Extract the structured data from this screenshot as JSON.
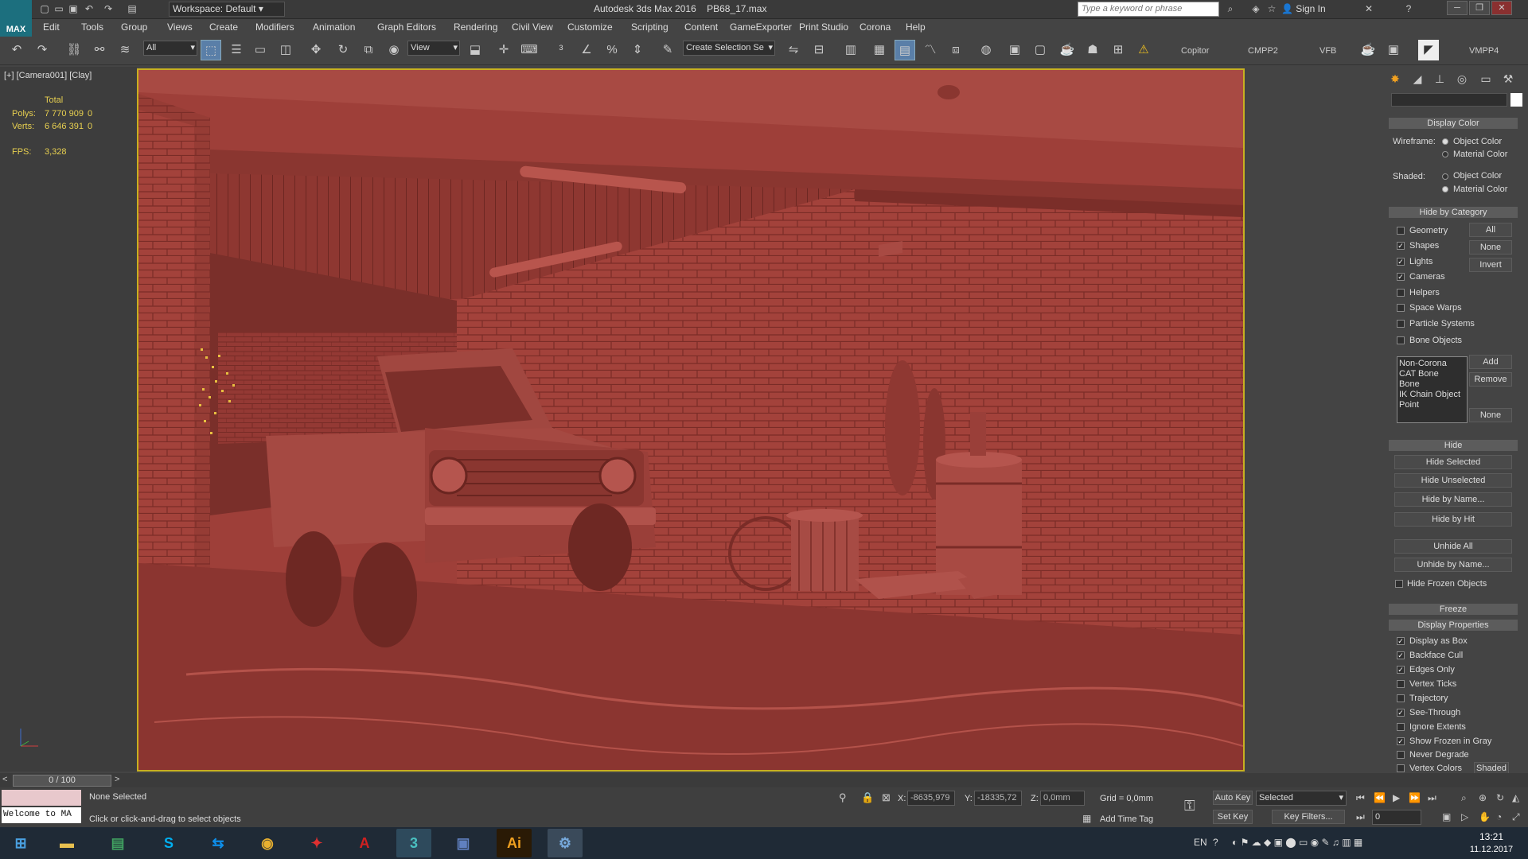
{
  "titlebar": {
    "logo": "MAX",
    "workspace": "Workspace: Default",
    "app_title": "Autodesk 3ds Max 2016",
    "file_name": "PB68_17.max",
    "search_placeholder": "Type a keyword or phrase",
    "sign_in": "Sign In"
  },
  "menubar": {
    "items": [
      "Edit",
      "Tools",
      "Group",
      "Views",
      "Create",
      "Modifiers",
      "Animation",
      "Graph Editors",
      "Rendering",
      "Civil View",
      "Customize",
      "Scripting",
      "Content",
      "GameExporter",
      "Print Studio",
      "Corona",
      "Help"
    ]
  },
  "toolbar": {
    "filter_value": "All",
    "refcoord_value": "View",
    "selection_set_placeholder": "Create Selection Se",
    "plugins": [
      "Copitor",
      "CMPP2",
      "VFB",
      "VMPP4"
    ]
  },
  "viewport": {
    "label": "[+] [Camera001] [Clay]",
    "stats": {
      "total_label": "Total",
      "polys_label": "Polys:",
      "polys_value": "7 770 909",
      "polys_sel": "0",
      "verts_label": "Verts:",
      "verts_value": "6 646 391",
      "verts_sel": "0",
      "fps_label": "FPS:",
      "fps_value": "3,328"
    },
    "colors": {
      "clay": "#9e3f39",
      "border": "#c8b020"
    }
  },
  "command_panel": {
    "display_color": {
      "title": "Display Color",
      "wireframe_label": "Wireframe:",
      "shaded_label": "Shaded:",
      "object_color": "Object Color",
      "material_color": "Material Color"
    },
    "hide_by_category": {
      "title": "Hide by Category",
      "items": [
        {
          "label": "Geometry",
          "checked": false
        },
        {
          "label": "Shapes",
          "checked": true
        },
        {
          "label": "Lights",
          "checked": true
        },
        {
          "label": "Cameras",
          "checked": true
        },
        {
          "label": "Helpers",
          "checked": false
        },
        {
          "label": "Space Warps",
          "checked": false
        },
        {
          "label": "Particle Systems",
          "checked": false
        },
        {
          "label": "Bone Objects",
          "checked": false
        }
      ],
      "btn_all": "All",
      "btn_none": "None",
      "btn_invert": "Invert",
      "exclusions": [
        "Non-Corona",
        "CAT Bone",
        "Bone",
        "IK Chain Object",
        "Point"
      ],
      "btn_add": "Add",
      "btn_remove": "Remove",
      "btn_none2": "None"
    },
    "hide": {
      "title": "Hide",
      "buttons": [
        "Hide Selected",
        "Hide Unselected",
        "Hide by Name...",
        "Hide by Hit",
        "Unhide All",
        "Unhide by Name..."
      ],
      "hide_frozen": "Hide Frozen Objects"
    },
    "freeze_title": "Freeze",
    "display_properties": {
      "title": "Display Properties",
      "items": [
        {
          "label": "Display as Box",
          "checked": true
        },
        {
          "label": "Backface Cull",
          "checked": true
        },
        {
          "label": "Edges Only",
          "checked": true
        },
        {
          "label": "Vertex Ticks",
          "checked": false
        },
        {
          "label": "Trajectory",
          "checked": false
        },
        {
          "label": "See-Through",
          "checked": true
        },
        {
          "label": "Ignore Extents",
          "checked": false
        },
        {
          "label": "Show Frozen in Gray",
          "checked": true
        },
        {
          "label": "Never Degrade",
          "checked": false
        },
        {
          "label": "Vertex Colors",
          "checked": false
        }
      ],
      "shaded_btn": "Shaded"
    }
  },
  "timeslider": {
    "frame": "0 / 100"
  },
  "statusbar": {
    "maxscript": "Welcome to MA",
    "selection": "None Selected",
    "prompt": "Click or click-and-drag to select objects",
    "x_label": "X:",
    "x_value": "-8635,979",
    "y_label": "Y:",
    "y_value": "-18335,72",
    "z_label": "Z:",
    "z_value": "0,0mm",
    "grid": "Grid = 0,0mm",
    "add_time_tag": "Add Time Tag",
    "auto_key": "Auto Key",
    "set_key": "Set Key",
    "key_mode": "Selected",
    "key_filters": "Key Filters...",
    "frame_value": "0"
  },
  "taskbar": {
    "lang": "EN",
    "time": "13:21",
    "date": "11.12.2017"
  }
}
